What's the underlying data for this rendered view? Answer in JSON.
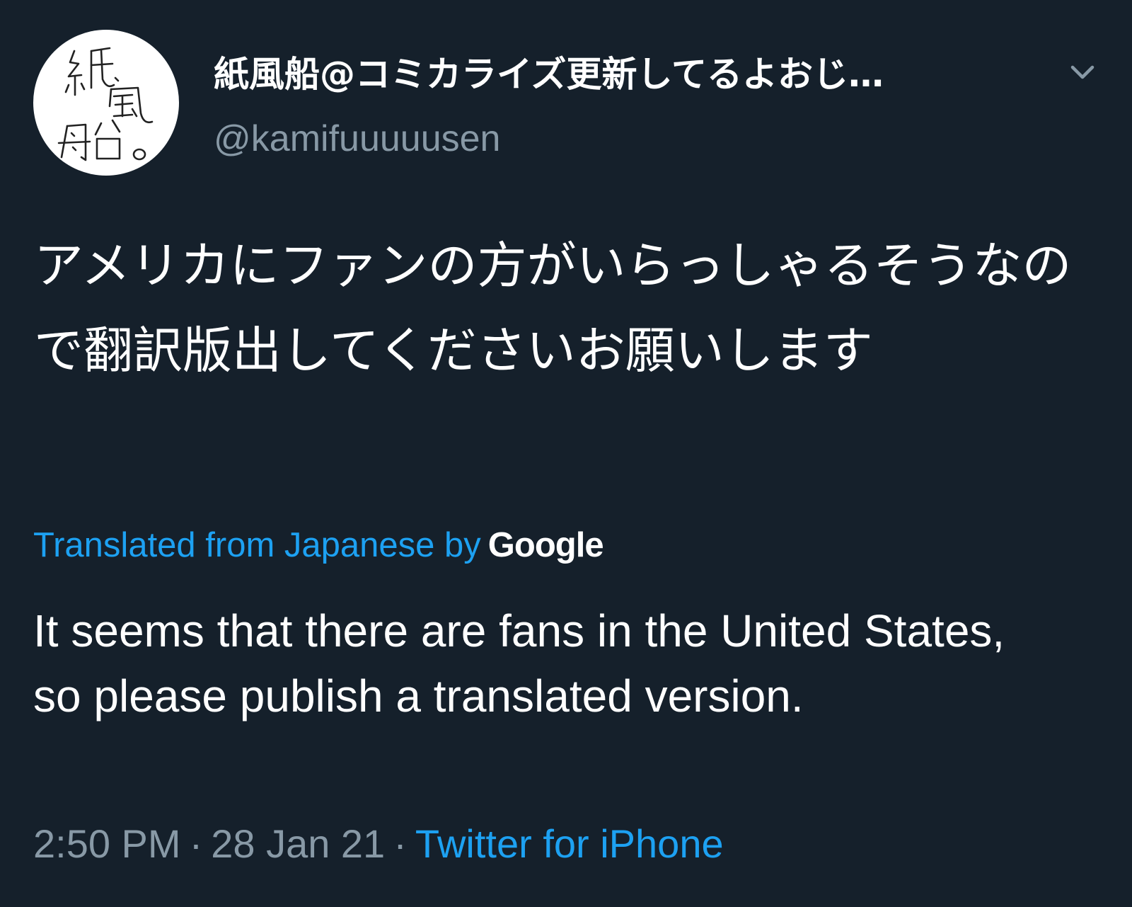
{
  "author": {
    "display_name": "紙風船@コミカライズ更新してるよおじ…",
    "handle": "@kamifuuuuusen",
    "avatar_text": "紙風船。"
  },
  "tweet": {
    "text": "アメリカにファンの方がいらっしゃるそうなので翻訳版出してくださいお願いします",
    "translated_label": "Translated from Japanese by",
    "translator": "Google",
    "translation": "It seems that there are fans in the United States, so please publish a translated version."
  },
  "meta": {
    "time": "2:50 PM",
    "separator": "·",
    "date": "28 Jan 21",
    "source": "Twitter for iPhone"
  },
  "icons": {
    "avatar": "avatar-calligraphy",
    "menu": "chevron-down-icon"
  },
  "colors": {
    "background": "#15202b",
    "text": "#ffffff",
    "secondary": "#8899a6",
    "accent": "#1da1f2"
  }
}
